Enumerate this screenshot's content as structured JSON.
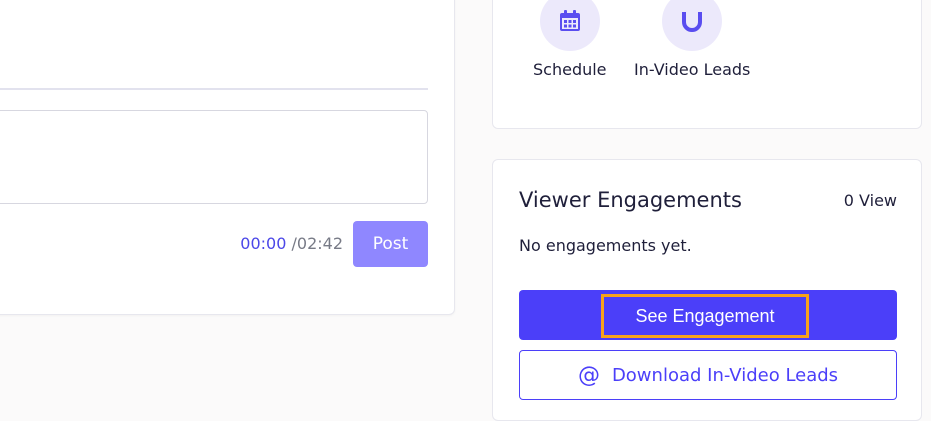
{
  "player": {
    "time_current": "00:00",
    "time_total": "/02:42",
    "post_label": "Post"
  },
  "actions": [
    {
      "label": "Schedule",
      "icon": "calendar-icon"
    },
    {
      "label": "In-Video Leads",
      "icon": "magnet-icon"
    }
  ],
  "engagements": {
    "title": "Viewer Engagements",
    "count": "0 View",
    "empty_text": "No engagements yet.",
    "see_label": "See Engagement",
    "download_label": "Download In-Video Leads",
    "download_icon": "at-icon"
  },
  "colors": {
    "primary": "#4b3ff9",
    "post_button": "#8f87ff",
    "highlight": "#f7a21b",
    "icon_bg": "#ece9fb"
  }
}
